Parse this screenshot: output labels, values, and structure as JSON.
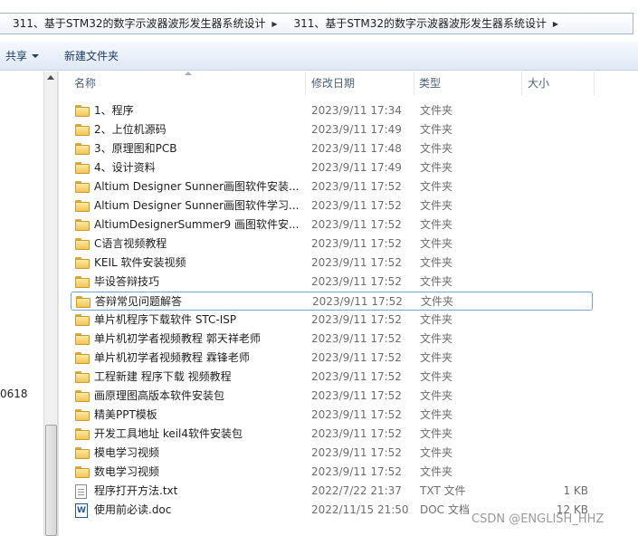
{
  "breadcrumb": {
    "items": [
      "311、基于STM32的数字示波器波形发生器系统设计",
      "311、基于STM32的数字示波器波形发生器系统设计"
    ],
    "sep": "▶"
  },
  "toolbar": {
    "share_label": "共享",
    "new_folder_label": "新建文件夹"
  },
  "nav": {
    "partial_text": "0618"
  },
  "columns": {
    "name": "名称",
    "date": "修改日期",
    "type": "类型",
    "size": "大小"
  },
  "files": [
    {
      "name": "1、程序",
      "date": "2023/9/11 17:34",
      "type": "文件夹",
      "size": "",
      "icon": "folder-icon"
    },
    {
      "name": "2、上位机源码",
      "date": "2023/9/11 17:49",
      "type": "文件夹",
      "size": "",
      "icon": "folder-icon"
    },
    {
      "name": "3、原理图和PCB",
      "date": "2023/9/11 17:48",
      "type": "文件夹",
      "size": "",
      "icon": "folder-icon"
    },
    {
      "name": "4、设计资料",
      "date": "2023/9/11 17:49",
      "type": "文件夹",
      "size": "",
      "icon": "folder-icon"
    },
    {
      "name": "Altium Designer Sunner画图软件安装...",
      "date": "2023/9/11 17:52",
      "type": "文件夹",
      "size": "",
      "icon": "folder-icon"
    },
    {
      "name": "Altium Designer Sunner画图软件学习...",
      "date": "2023/9/11 17:52",
      "type": "文件夹",
      "size": "",
      "icon": "folder-icon"
    },
    {
      "name": "AltiumDesignerSummer9 画图软件安...",
      "date": "2023/9/11 17:52",
      "type": "文件夹",
      "size": "",
      "icon": "folder-icon"
    },
    {
      "name": "C语言视频教程",
      "date": "2023/9/11 17:52",
      "type": "文件夹",
      "size": "",
      "icon": "folder-icon"
    },
    {
      "name": "KEIL 软件安装视频",
      "date": "2023/9/11 17:52",
      "type": "文件夹",
      "size": "",
      "icon": "folder-icon"
    },
    {
      "name": "毕设答辩技巧",
      "date": "2023/9/11 17:52",
      "type": "文件夹",
      "size": "",
      "icon": "folder-icon"
    },
    {
      "name": "答辩常见问题解答",
      "date": "2023/9/11 17:52",
      "type": "文件夹",
      "size": "",
      "icon": "folder-icon",
      "selected": true
    },
    {
      "name": "单片机程序下载软件 STC-ISP",
      "date": "2023/9/11 17:52",
      "type": "文件夹",
      "size": "",
      "icon": "folder-icon"
    },
    {
      "name": "单片机初学者视频教程 郭天祥老师",
      "date": "2023/9/11 17:52",
      "type": "文件夹",
      "size": "",
      "icon": "folder-icon"
    },
    {
      "name": "单片机初学者视频教程 霖锋老师",
      "date": "2023/9/11 17:52",
      "type": "文件夹",
      "size": "",
      "icon": "folder-icon"
    },
    {
      "name": "工程新建 程序下载 视频教程",
      "date": "2023/9/11 17:52",
      "type": "文件夹",
      "size": "",
      "icon": "folder-icon"
    },
    {
      "name": "画原理图高版本软件安装包",
      "date": "2023/9/11 17:52",
      "type": "文件夹",
      "size": "",
      "icon": "folder-icon"
    },
    {
      "name": "精美PPT模板",
      "date": "2023/9/11 17:52",
      "type": "文件夹",
      "size": "",
      "icon": "folder-icon"
    },
    {
      "name": "开发工具地址 keil4软件安装包",
      "date": "2023/9/11 17:52",
      "type": "文件夹",
      "size": "",
      "icon": "folder-icon"
    },
    {
      "name": "模电学习视频",
      "date": "2023/9/11 17:52",
      "type": "文件夹",
      "size": "",
      "icon": "folder-icon"
    },
    {
      "name": "数电学习视频",
      "date": "2023/9/11 17:52",
      "type": "文件夹",
      "size": "",
      "icon": "folder-icon"
    },
    {
      "name": "程序打开方法.txt",
      "date": "2022/7/22 21:37",
      "type": "TXT 文件",
      "size": "1 KB",
      "icon": "text-file-icon"
    },
    {
      "name": "使用前必读.doc",
      "date": "2022/11/15 21:50",
      "type": "DOC 文档",
      "size": "12 KB",
      "icon": "word-doc-icon"
    }
  ],
  "watermark": "CSDN @ENGLISH_HHZ"
}
